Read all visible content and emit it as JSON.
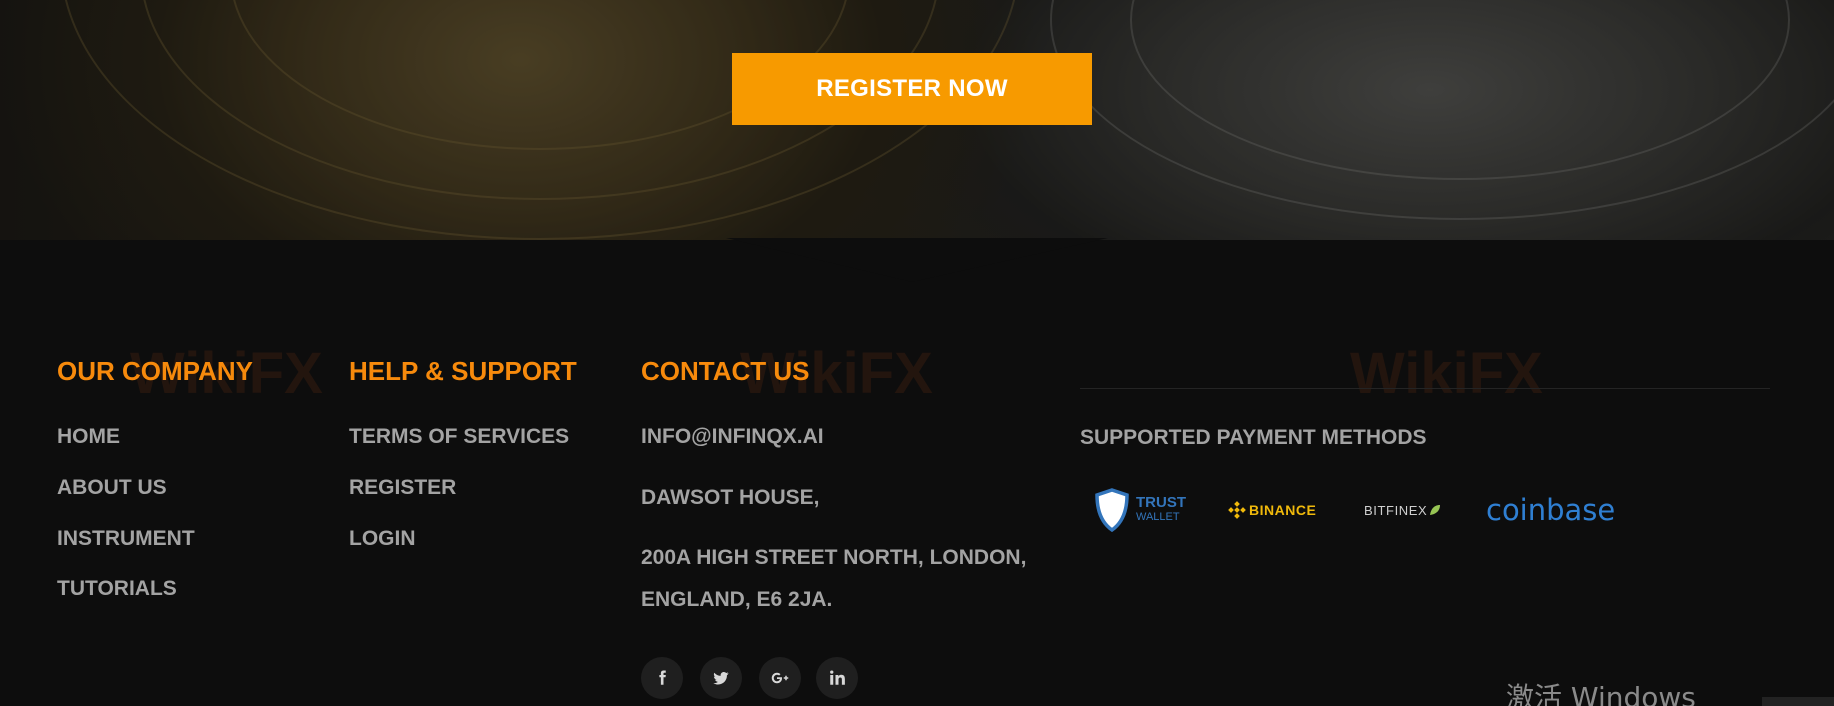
{
  "hero": {
    "register_label": "REGISTER NOW"
  },
  "footer": {
    "company": {
      "heading": "OUR COMPANY",
      "links": [
        "HOME",
        "ABOUT US",
        "INSTRUMENT",
        "TUTORIALS"
      ]
    },
    "help": {
      "heading": "HELP & SUPPORT",
      "links": [
        "TERMS OF SERVICES",
        "REGISTER",
        "LOGIN"
      ]
    },
    "contact": {
      "heading": "CONTACT US",
      "email": "INFO@INFINQX.AI",
      "address_line1": "DAWSOT HOUSE,",
      "address_line2": "200A HIGH STREET NORTH, LONDON,",
      "address_line3": "ENGLAND, E6 2JA.",
      "social_icons": [
        "facebook-icon",
        "twitter-icon",
        "google-plus-icon",
        "linkedin-icon"
      ]
    },
    "payments": {
      "heading": "SUPPORTED PAYMENT METHODS",
      "methods": [
        {
          "name_line1": "TRUST",
          "name_line2": "WALLET",
          "color": "#3375bb"
        },
        {
          "name": "BINANCE",
          "color": "#f0b90b"
        },
        {
          "name": "BITFINEX",
          "color": "#cfcfcf",
          "leaf_color": "#97c554"
        },
        {
          "name": "coinbase",
          "color": "#2f7fd2"
        }
      ]
    }
  },
  "os_notice": {
    "text": "激活 Windows"
  },
  "watermark": {
    "text": "WikiFX"
  },
  "colors": {
    "accent": "#f79a00",
    "heading": "#f78a0c",
    "link": "#a3a3a3",
    "footer_bg": "#0d0d0d"
  }
}
